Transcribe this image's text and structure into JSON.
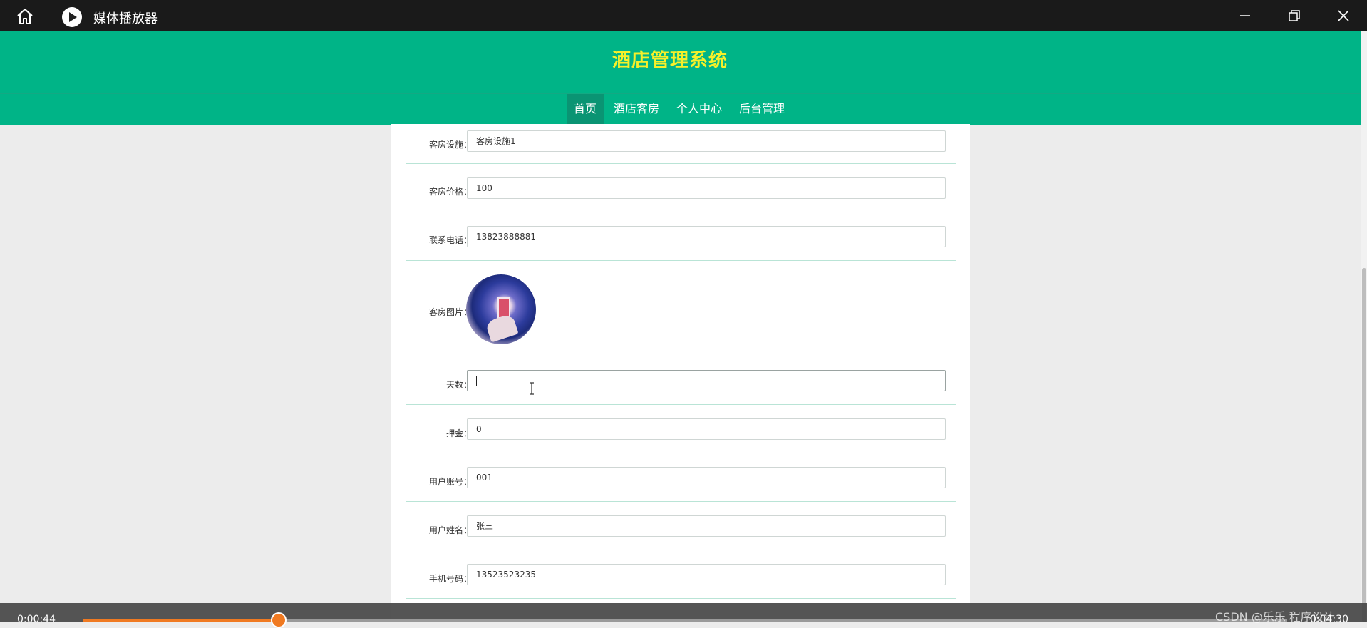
{
  "player": {
    "app_title": "媒体播放器",
    "icons": {
      "home": "home-icon",
      "app": "media-player-icon",
      "minimize": "minimize-icon",
      "maximize": "restore-icon",
      "close": "close-icon"
    },
    "time_elapsed": "0:00:44",
    "time_total": "0:04:30",
    "progress": 0.163,
    "watermark": "CSDN @乐乐 程序设计"
  },
  "site": {
    "title": "酒店管理系统",
    "nav": [
      {
        "label": "首页",
        "active": true
      },
      {
        "label": "酒店客房",
        "active": false
      },
      {
        "label": "个人中心",
        "active": false
      },
      {
        "label": "后台管理",
        "active": false
      }
    ]
  },
  "form": {
    "fields": [
      {
        "label": "客房设施：",
        "value": "客房设施1"
      },
      {
        "label": "客房价格：",
        "value": "100"
      },
      {
        "label": "联系电话：",
        "value": "13823888881"
      },
      {
        "label": "客房图片："
      },
      {
        "label": "天数：",
        "value": ""
      },
      {
        "label": "押金：",
        "value": "0"
      },
      {
        "label": "用户账号：",
        "value": "001"
      },
      {
        "label": "用户姓名：",
        "value": "张三"
      },
      {
        "label": "手机号码：",
        "value": "13523523235"
      }
    ]
  },
  "colors": {
    "header": "#00b487",
    "title": "#f6f02a",
    "progress": "#f07a22"
  }
}
